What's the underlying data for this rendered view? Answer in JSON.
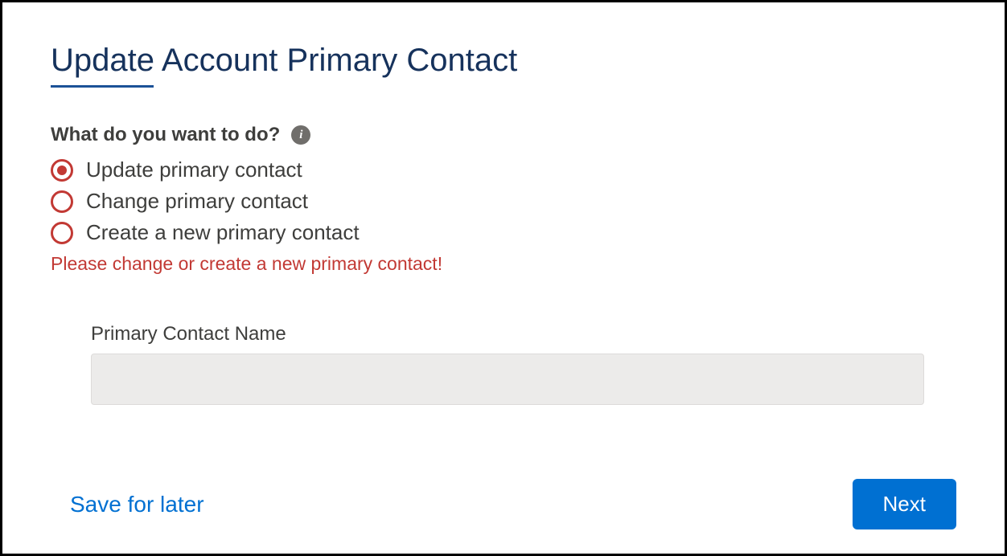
{
  "title": "Update Account Primary Contact",
  "prompt": "What do you want to do?",
  "options": [
    {
      "label": "Update primary contact",
      "selected": true
    },
    {
      "label": "Change primary contact",
      "selected": false
    },
    {
      "label": "Create a new primary contact",
      "selected": false
    }
  ],
  "error_message": "Please change or create a new primary contact!",
  "input": {
    "label": "Primary Contact Name",
    "value": ""
  },
  "footer": {
    "save_label": "Save for later",
    "next_label": "Next"
  },
  "icons": {
    "info": "i"
  }
}
